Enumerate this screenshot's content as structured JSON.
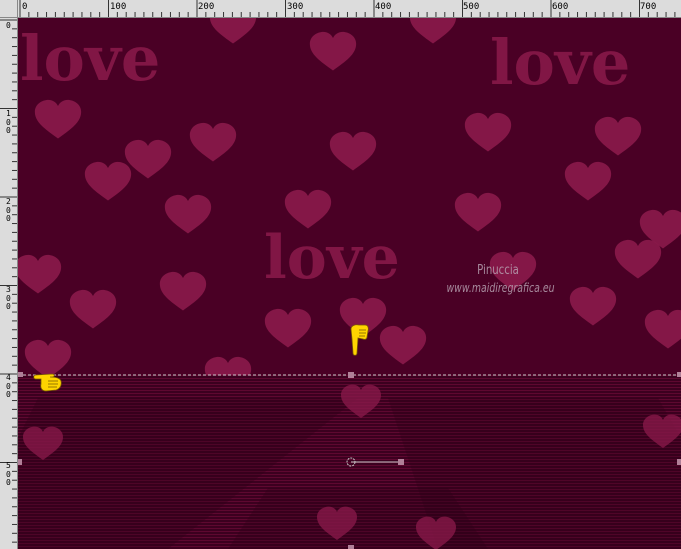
{
  "rulers": {
    "horizontal": [
      "0",
      "100",
      "200",
      "300",
      "400",
      "500",
      "600",
      "700"
    ],
    "vertical": [
      "0",
      "100",
      "200",
      "300",
      "400",
      "500"
    ]
  },
  "canvas": {
    "background": "#4a0025",
    "floor_color": "#3c001f",
    "heart_color": "#8b1a4b",
    "love_color": "#8b1a4b"
  },
  "words": {
    "love": "love"
  },
  "watermark": {
    "name": "Pinuccia",
    "url": "www.maidiregrafica.eu"
  },
  "guides": {
    "color": "#c8c8c8",
    "handle_color": "#b08098"
  },
  "pointers": {
    "color": "#ffd400",
    "icon_name": "pointing-hand-icon"
  }
}
